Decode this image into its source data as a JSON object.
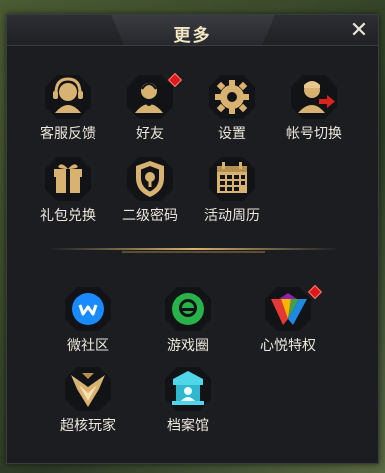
{
  "header": {
    "title": "更多",
    "close_icon": "close-icon"
  },
  "row1": [
    {
      "label": "客服反馈",
      "icon": "customer-service-headset-icon"
    },
    {
      "label": "好友",
      "icon": "friends-icon",
      "badge": true
    },
    {
      "label": "设置",
      "icon": "gear-icon"
    },
    {
      "label": "帐号切换",
      "icon": "account-switch-icon"
    }
  ],
  "row2": [
    {
      "label": "礼包兑换",
      "icon": "gift-box-icon"
    },
    {
      "label": "二级密码",
      "icon": "shield-lock-icon"
    },
    {
      "label": "活动周历",
      "icon": "calendar-icon"
    }
  ],
  "social1": [
    {
      "label": "微社区",
      "icon": "micro-community-icon"
    },
    {
      "label": "游戏圈",
      "icon": "game-circle-icon"
    },
    {
      "label": "心悦特权",
      "icon": "xinyue-privilege-icon",
      "badge": true
    }
  ],
  "social2": [
    {
      "label": "超核玩家",
      "icon": "super-core-player-icon"
    },
    {
      "label": "档案馆",
      "icon": "archive-icon"
    }
  ],
  "colors": {
    "gold": "#d8b270",
    "panel_bg": "#1b1d21",
    "badge_red": "#e0181b",
    "label_text": "#ece7db"
  }
}
